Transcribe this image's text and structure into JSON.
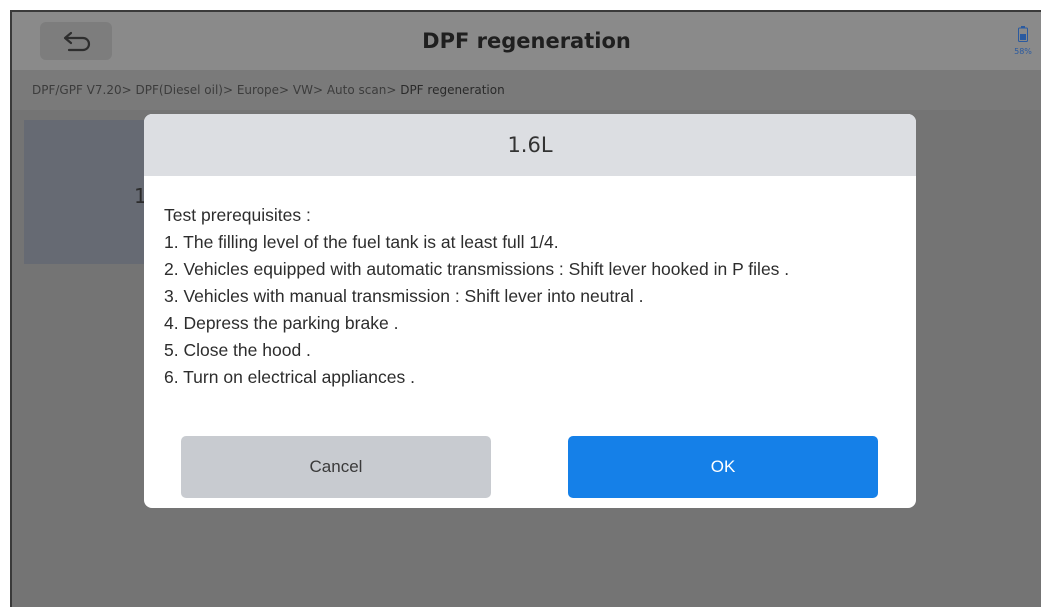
{
  "header": {
    "title": "DPF regeneration",
    "battery_label": "58%"
  },
  "breadcrumb": {
    "path": "DPF/GPF V7.20> DPF(Diesel oil)> Europe> VW> Auto scan> ",
    "current": "DPF regeneration"
  },
  "background": {
    "card_label": "1."
  },
  "dialog": {
    "title": "1.6L",
    "lines": [
      "Test prerequisites :",
      "1. The filling level of the fuel tank is at least full 1/4.",
      "2. Vehicles equipped with automatic transmissions : Shift lever hooked in P files .",
      "3. Vehicles with manual transmission : Shift lever into neutral .",
      "4. Depress the parking brake .",
      "5. Close the hood .",
      "6. Turn on electrical appliances ."
    ],
    "cancel_label": "Cancel",
    "ok_label": "OK"
  },
  "colors": {
    "accent": "#1580e8",
    "overlay": "#747474",
    "dialog_header": "#dcdee2"
  },
  "icons": {
    "back": "back-arrow-icon",
    "battery": "battery-icon"
  }
}
